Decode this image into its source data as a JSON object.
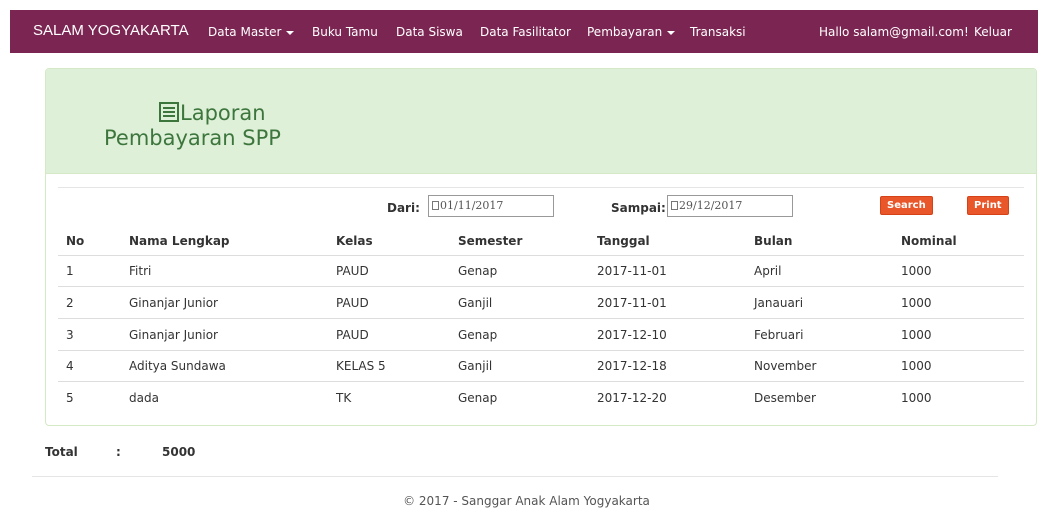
{
  "navbar": {
    "brand": "SALAM YOGYAKARTA",
    "items": [
      {
        "label": "Data Master",
        "dropdown": true
      },
      {
        "label": "Buku Tamu",
        "dropdown": false
      },
      {
        "label": "Data Siswa",
        "dropdown": false
      },
      {
        "label": "Data Fasilitator",
        "dropdown": false
      },
      {
        "label": "Pembayaran",
        "dropdown": true
      },
      {
        "label": "Transaksi",
        "dropdown": false
      }
    ],
    "greeting": "Hallo salam@gmail.com!",
    "logout": "Keluar",
    "color": "#7b2552"
  },
  "report": {
    "title_line1": "Laporan",
    "title_line2": "Pembayaran SPP",
    "icon": "list-alt-icon"
  },
  "filter": {
    "from_label": "Dari:",
    "from_value": "01/11/2017",
    "to_label": "Sampai:",
    "to_value": "29/12/2017",
    "search_button": "Search",
    "print_button": "Print"
  },
  "table": {
    "headers": [
      "No",
      "Nama Lengkap",
      "Kelas",
      "Semester",
      "Tanggal",
      "Bulan",
      "Nominal"
    ],
    "rows": [
      [
        "1",
        "Fitri",
        "PAUD",
        "Genap",
        "2017-11-01",
        "April",
        "1000"
      ],
      [
        "2",
        "Ginanjar Junior",
        "PAUD",
        "Ganjil",
        "2017-11-01",
        "Janauari",
        "1000"
      ],
      [
        "3",
        "Ginanjar Junior",
        "PAUD",
        "Genap",
        "2017-12-10",
        "Februari",
        "1000"
      ],
      [
        "4",
        "Aditya Sundawa",
        "KELAS 5",
        "Ganjil",
        "2017-12-18",
        "November",
        "1000"
      ],
      [
        "5",
        "dada",
        "TK",
        "Genap",
        "2017-12-20",
        "Desember",
        "1000"
      ]
    ]
  },
  "total": {
    "label": "Total",
    "separator": ":",
    "value": "5000"
  },
  "footer": {
    "copyright": "© 2017 - Sanggar Anak Alam Yogyakarta"
  }
}
